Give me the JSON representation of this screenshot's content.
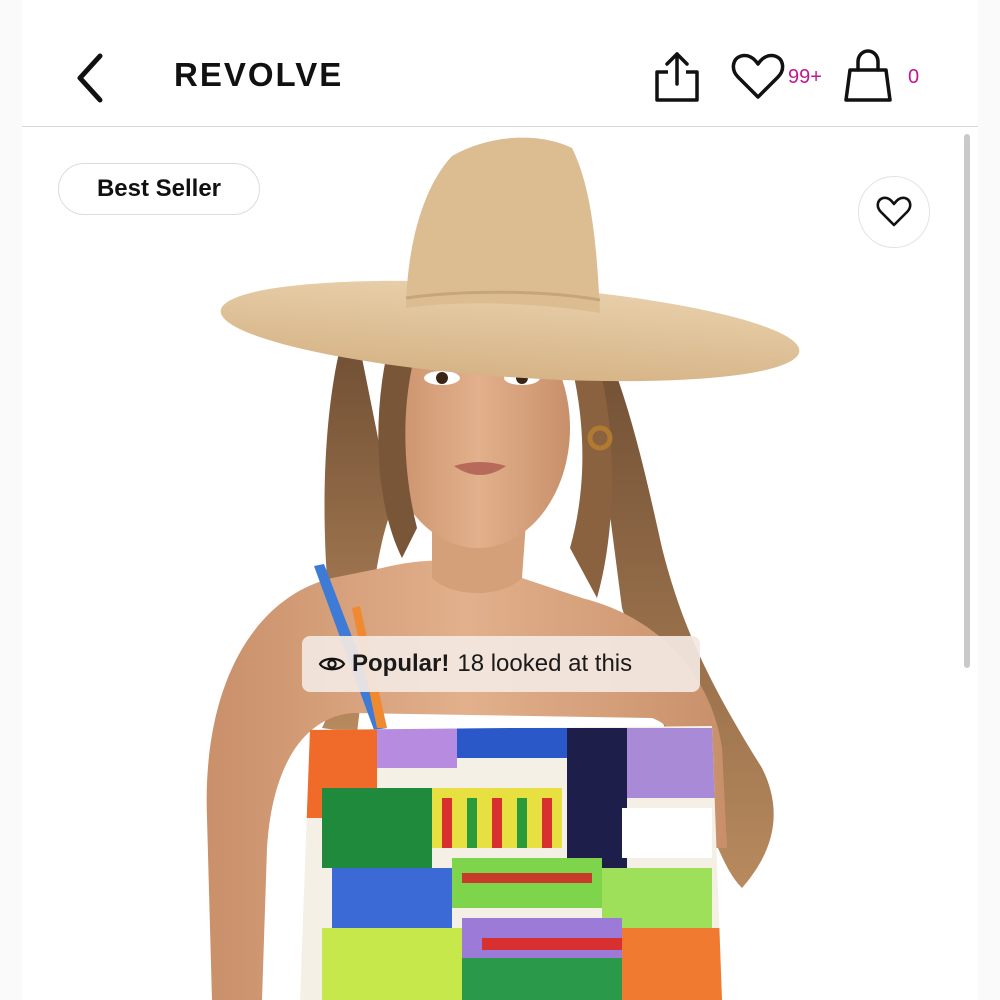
{
  "header": {
    "logo": "REVOLVE",
    "wishlist_count": "99+",
    "bag_count": "0"
  },
  "product": {
    "badge": "Best Seller",
    "popular_label": "Popular!",
    "popular_text": "18 looked at this"
  },
  "icons": {
    "back": "chevron-left-icon",
    "share": "share-icon",
    "wishlist": "heart-icon",
    "bag": "shopping-bag-icon",
    "favorite": "heart-outline-icon",
    "popular": "eye-icon"
  },
  "colors": {
    "accent_count": "#c2188f",
    "text": "#111111",
    "badge_bg": "#f3e8e2"
  }
}
